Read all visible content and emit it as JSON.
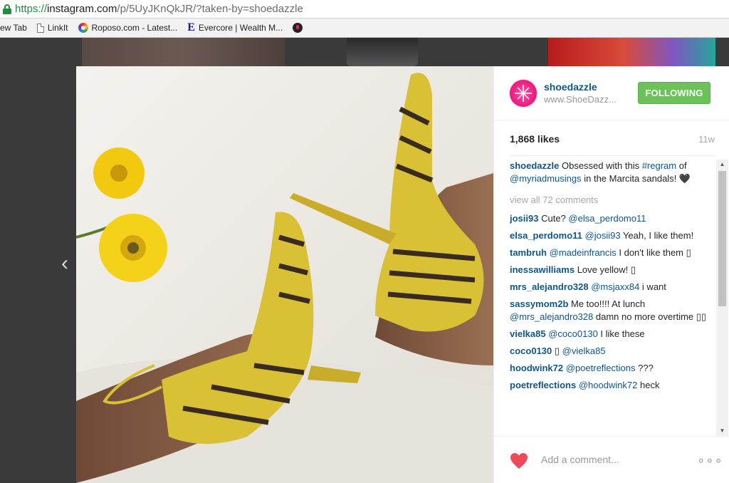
{
  "browser": {
    "url_scheme": "https://",
    "url_host": "instagram.com",
    "url_path": "/p/5UyJKnQkJR/?taken-by=shoedazzle"
  },
  "bookmarks": [
    {
      "label": "ew Tab",
      "icon": "none"
    },
    {
      "label": "LinkIt",
      "icon": "document-icon"
    },
    {
      "label": "Roposo.com - Latest...",
      "icon": "roposo-icon"
    },
    {
      "label": "Evercore | Wealth M...",
      "icon": "evercore-icon"
    },
    {
      "label": "",
      "icon": "dark-circle-icon"
    }
  ],
  "post": {
    "username": "shoedazzle",
    "website": "www.ShoeDazz...",
    "follow_label": "FOLLOWING",
    "likes": "1,868 likes",
    "age": "11w",
    "caption": {
      "user": "shoedazzle",
      "text1": "Obsessed with this ",
      "hashtag": "#regram",
      "text2": " of ",
      "mention": "@myriadmusings",
      "text3": " in the Marcita sandals! 🖤"
    },
    "view_all": "view all 72 comments",
    "add_comment_placeholder": "Add a comment...",
    "more": "ooo"
  },
  "comments": [
    {
      "user": "josii93",
      "parts": [
        {
          "t": "Cute? ",
          "link": false
        },
        {
          "t": "@elsa_perdomo11",
          "link": true
        }
      ]
    },
    {
      "user": "elsa_perdomo11",
      "parts": [
        {
          "t": "@josii93",
          "link": true
        },
        {
          "t": " Yeah, I like them!",
          "link": false
        }
      ]
    },
    {
      "user": "tambruh",
      "parts": [
        {
          "t": "@madeinfrancis",
          "link": true
        },
        {
          "t": " I don't like them ▯",
          "link": false
        }
      ]
    },
    {
      "user": "inessawilliams",
      "parts": [
        {
          "t": "Love yellow! ▯",
          "link": false
        }
      ]
    },
    {
      "user": "mrs_alejandro328",
      "parts": [
        {
          "t": "@msjaxx84",
          "link": true
        },
        {
          "t": " i want",
          "link": false
        }
      ]
    },
    {
      "user": "sassymom2b",
      "parts": [
        {
          "t": "Me too!!!! At lunch ",
          "link": false
        },
        {
          "t": "@mrs_alejandro328",
          "link": true
        },
        {
          "t": " damn no more overtime ▯▯",
          "link": false
        }
      ]
    },
    {
      "user": "vielka85",
      "parts": [
        {
          "t": "@coco0130",
          "link": true
        },
        {
          "t": " I like these",
          "link": false
        }
      ]
    },
    {
      "user": "coco0130",
      "parts": [
        {
          "t": "▯ ",
          "link": false
        },
        {
          "t": "@vielka85",
          "link": true
        }
      ]
    },
    {
      "user": "hoodwink72",
      "parts": [
        {
          "t": "@poetreflections",
          "link": true
        },
        {
          "t": " ???",
          "link": false
        }
      ]
    },
    {
      "user": "poetreflections",
      "parts": [
        {
          "t": "@hoodwink72",
          "link": true
        },
        {
          "t": " heck",
          "link": false
        }
      ]
    }
  ],
  "colors": {
    "follow_green": "#6bc259",
    "username_blue": "#125688",
    "heart_red": "#ed4956",
    "shoe_yellow": "#d9c035"
  }
}
